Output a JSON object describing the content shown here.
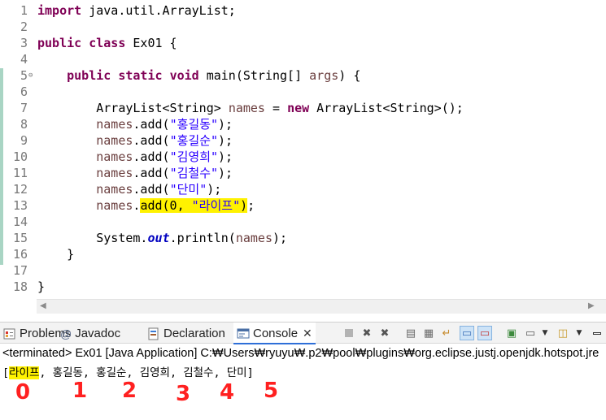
{
  "editor": {
    "lines": [
      {
        "n": "1",
        "segs": [
          {
            "t": "import",
            "c": "kw"
          },
          {
            "t": " java.util.ArrayList;"
          }
        ]
      },
      {
        "n": "2",
        "segs": []
      },
      {
        "n": "3",
        "segs": [
          {
            "t": "public",
            "c": "kw"
          },
          {
            "t": " "
          },
          {
            "t": "class",
            "c": "kw"
          },
          {
            "t": " Ex01 {"
          }
        ]
      },
      {
        "n": "4",
        "segs": []
      },
      {
        "n": "5",
        "fold": "⊖",
        "segs": [
          {
            "t": "    "
          },
          {
            "t": "public",
            "c": "kw"
          },
          {
            "t": " "
          },
          {
            "t": "static",
            "c": "kw"
          },
          {
            "t": " "
          },
          {
            "t": "void",
            "c": "kw"
          },
          {
            "t": " main(String[] "
          },
          {
            "t": "args",
            "c": "var"
          },
          {
            "t": ") {"
          }
        ]
      },
      {
        "n": "6",
        "segs": []
      },
      {
        "n": "7",
        "segs": [
          {
            "t": "        ArrayList<String> "
          },
          {
            "t": "names",
            "c": "var"
          },
          {
            "t": " = "
          },
          {
            "t": "new",
            "c": "kw"
          },
          {
            "t": " ArrayList<String>();"
          }
        ]
      },
      {
        "n": "8",
        "segs": [
          {
            "t": "        "
          },
          {
            "t": "names",
            "c": "var"
          },
          {
            "t": ".add("
          },
          {
            "t": "\"홍길동\"",
            "c": "str"
          },
          {
            "t": ");"
          }
        ]
      },
      {
        "n": "9",
        "segs": [
          {
            "t": "        "
          },
          {
            "t": "names",
            "c": "var"
          },
          {
            "t": ".add("
          },
          {
            "t": "\"홍길순\"",
            "c": "str"
          },
          {
            "t": ");"
          }
        ]
      },
      {
        "n": "10",
        "segs": [
          {
            "t": "        "
          },
          {
            "t": "names",
            "c": "var"
          },
          {
            "t": ".add("
          },
          {
            "t": "\"김영희\"",
            "c": "str"
          },
          {
            "t": ");"
          }
        ]
      },
      {
        "n": "11",
        "segs": [
          {
            "t": "        "
          },
          {
            "t": "names",
            "c": "var"
          },
          {
            "t": ".add("
          },
          {
            "t": "\"김철수\"",
            "c": "str"
          },
          {
            "t": ");"
          }
        ]
      },
      {
        "n": "12",
        "segs": [
          {
            "t": "        "
          },
          {
            "t": "names",
            "c": "var"
          },
          {
            "t": ".add("
          },
          {
            "t": "\"단미\"",
            "c": "str"
          },
          {
            "t": ");"
          }
        ]
      },
      {
        "n": "13",
        "segs": [
          {
            "t": "        "
          },
          {
            "t": "names",
            "c": "var"
          },
          {
            "t": "."
          },
          {
            "t": "add(0, ",
            "h": true
          },
          {
            "t": "\"라이프\"",
            "c": "str",
            "h": true
          },
          {
            "t": ")",
            "h": true
          },
          {
            "t": ";"
          }
        ]
      },
      {
        "n": "14",
        "segs": []
      },
      {
        "n": "15",
        "segs": [
          {
            "t": "        System."
          },
          {
            "t": "out",
            "c": "sfld"
          },
          {
            "t": ".println("
          },
          {
            "t": "names",
            "c": "var"
          },
          {
            "t": ");"
          }
        ]
      },
      {
        "n": "16",
        "segs": [
          {
            "t": "    }"
          }
        ]
      },
      {
        "n": "17",
        "segs": []
      },
      {
        "n": "18",
        "segs": [
          {
            "t": "}"
          }
        ]
      }
    ]
  },
  "view_tabs": {
    "problems": "Problems",
    "javadoc": "Javadoc",
    "declaration": "Declaration",
    "console": "Console"
  },
  "console": {
    "terminated": "<terminated> Ex01 [Java Application] C:₩Users₩ryuyu₩.p2₩pool₩plugins₩org.eclipse.justj.openjdk.hotspot.jre",
    "output_open": "[",
    "output_first": "라이프",
    "output_rest": ", 홍길동, 홍길순, 김영희, 김철수, 단미]"
  },
  "annotations": [
    "0",
    "1",
    "2",
    "3",
    "4",
    "5"
  ],
  "colors": {
    "keyword": "#7f0055",
    "string": "#2a00ff",
    "highlight": "#fff200",
    "annotation": "#ff2020"
  }
}
